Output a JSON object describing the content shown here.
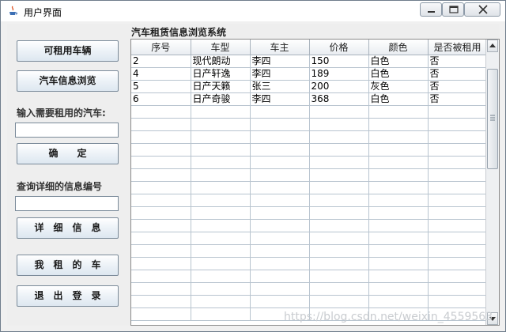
{
  "window": {
    "title": "用户界面",
    "controls": {
      "minimize": "minimize",
      "maximize": "maximize",
      "close": "close"
    }
  },
  "sidebar": {
    "available_cars_button": "可租用车辆",
    "browse_info_button": "汽车信息浏览",
    "rent_input_label": "输入需要租用的汽车:",
    "rent_input_value": "",
    "confirm_button": "确　　定",
    "detail_query_label": "查询详细的信息编号",
    "detail_input_value": "",
    "detail_button": "详　细　信　息",
    "my_cars_button": "我　租　的　车",
    "logout_button": "退　出　登　录"
  },
  "table": {
    "title": "汽车租赁信息浏览系统",
    "columns": [
      "序号",
      "车型",
      "车主",
      "价格",
      "颜色",
      "是否被租用"
    ],
    "rows": [
      [
        "2",
        "现代朗动",
        "李四",
        "150",
        "白色",
        "否"
      ],
      [
        "4",
        "日产轩逸",
        "李四",
        "189",
        "白色",
        "否"
      ],
      [
        "5",
        "日产天籁",
        "张三",
        "200",
        "灰色",
        "否"
      ],
      [
        "6",
        "日产奇骏",
        "李四",
        "368",
        "白色",
        "否"
      ]
    ],
    "empty_row_count": 17
  },
  "watermark": "https://blog.csdn.net/weixin_4559563"
}
